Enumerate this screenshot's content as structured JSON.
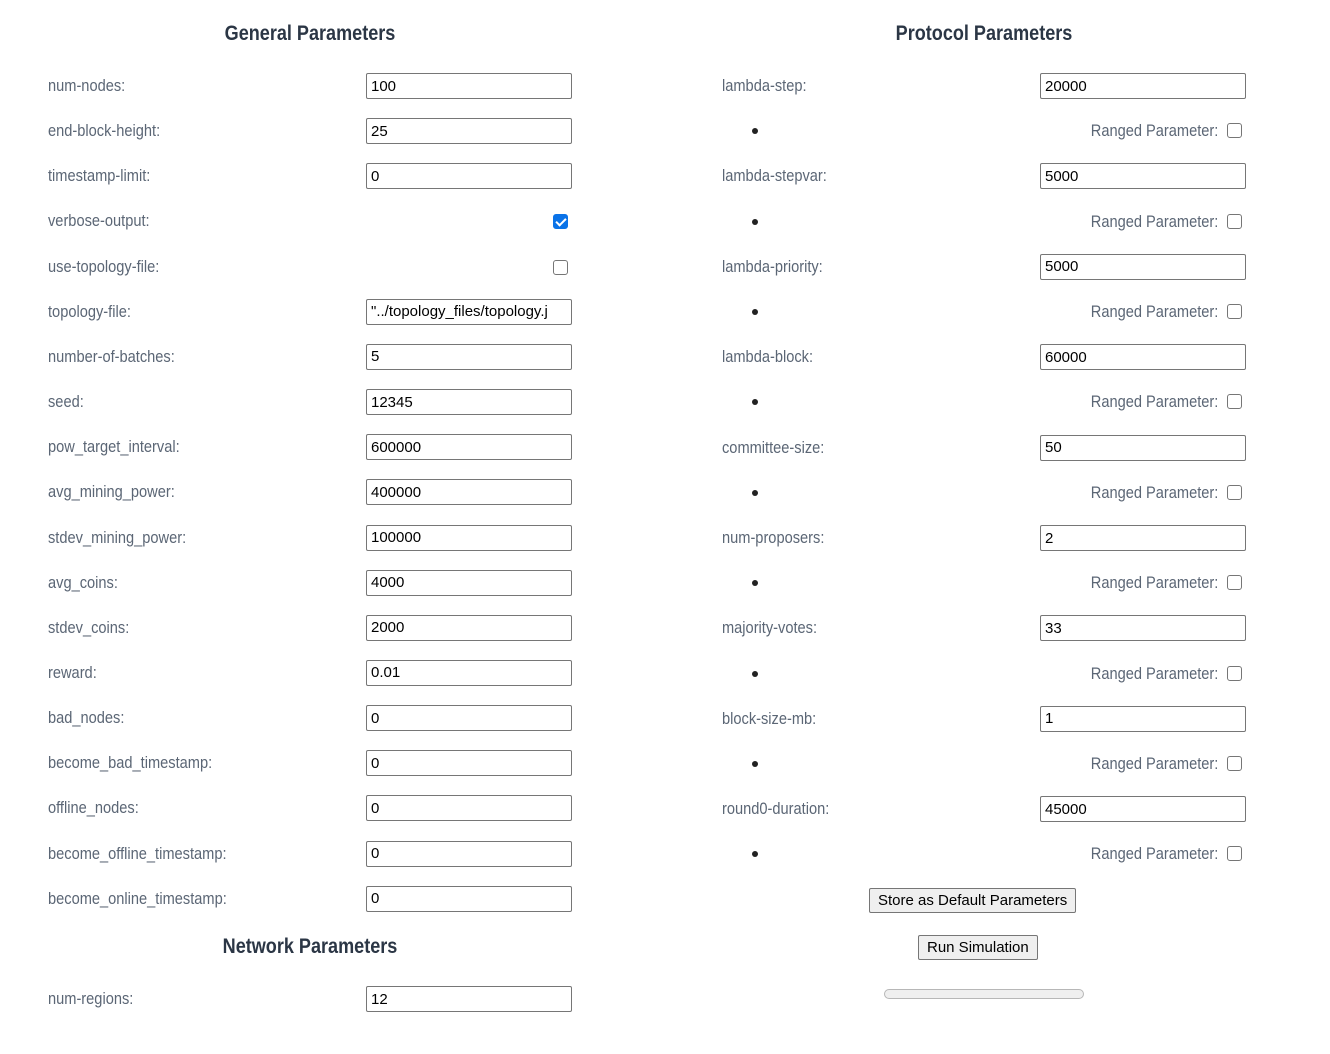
{
  "general": {
    "title": "General Parameters",
    "fields": [
      {
        "label": "num-nodes:",
        "type": "text",
        "value": "100"
      },
      {
        "label": "end-block-height:",
        "type": "text",
        "value": "25"
      },
      {
        "label": "timestamp-limit:",
        "type": "text",
        "value": "0"
      },
      {
        "label": "verbose-output:",
        "type": "checkbox",
        "checked": true
      },
      {
        "label": "use-topology-file:",
        "type": "checkbox",
        "checked": false
      },
      {
        "label": "topology-file:",
        "type": "text",
        "value": "\"../topology_files/topology.j"
      },
      {
        "label": "number-of-batches:",
        "type": "text",
        "value": "5"
      },
      {
        "label": "seed:",
        "type": "text",
        "value": "12345"
      },
      {
        "label": "pow_target_interval:",
        "type": "text",
        "value": "600000"
      },
      {
        "label": "avg_mining_power:",
        "type": "text",
        "value": "400000"
      },
      {
        "label": "stdev_mining_power:",
        "type": "text",
        "value": "100000"
      },
      {
        "label": "avg_coins:",
        "type": "text",
        "value": "4000"
      },
      {
        "label": "stdev_coins:",
        "type": "text",
        "value": "2000"
      },
      {
        "label": "reward:",
        "type": "text",
        "value": "0.01"
      },
      {
        "label": "bad_nodes:",
        "type": "text",
        "value": "0"
      },
      {
        "label": "become_bad_timestamp:",
        "type": "text",
        "value": "0"
      },
      {
        "label": "offline_nodes:",
        "type": "text",
        "value": "0"
      },
      {
        "label": "become_offline_timestamp:",
        "type": "text",
        "value": "0"
      },
      {
        "label": "become_online_timestamp:",
        "type": "text",
        "value": "0"
      }
    ]
  },
  "network": {
    "title": "Network Parameters",
    "fields": [
      {
        "label": "num-regions:",
        "type": "text",
        "value": "12"
      }
    ]
  },
  "protocol": {
    "title": "Protocol Parameters",
    "ranged_label": "Ranged Parameter:",
    "fields": [
      {
        "label": "lambda-step:",
        "value": "20000",
        "ranged": false
      },
      {
        "label": "lambda-stepvar:",
        "value": "5000",
        "ranged": false
      },
      {
        "label": "lambda-priority:",
        "value": "5000",
        "ranged": false
      },
      {
        "label": "lambda-block:",
        "value": "60000",
        "ranged": false
      },
      {
        "label": "committee-size:",
        "value": "50",
        "ranged": false
      },
      {
        "label": "num-proposers:",
        "value": "2",
        "ranged": false
      },
      {
        "label": "majority-votes:",
        "value": "33",
        "ranged": false
      },
      {
        "label": "block-size-mb:",
        "value": "1",
        "ranged": false
      },
      {
        "label": "round0-duration:",
        "value": "45000",
        "ranged": false
      }
    ]
  },
  "actions": {
    "store_label": "Store as Default Parameters",
    "run_label": "Run Simulation",
    "progress": 0
  }
}
